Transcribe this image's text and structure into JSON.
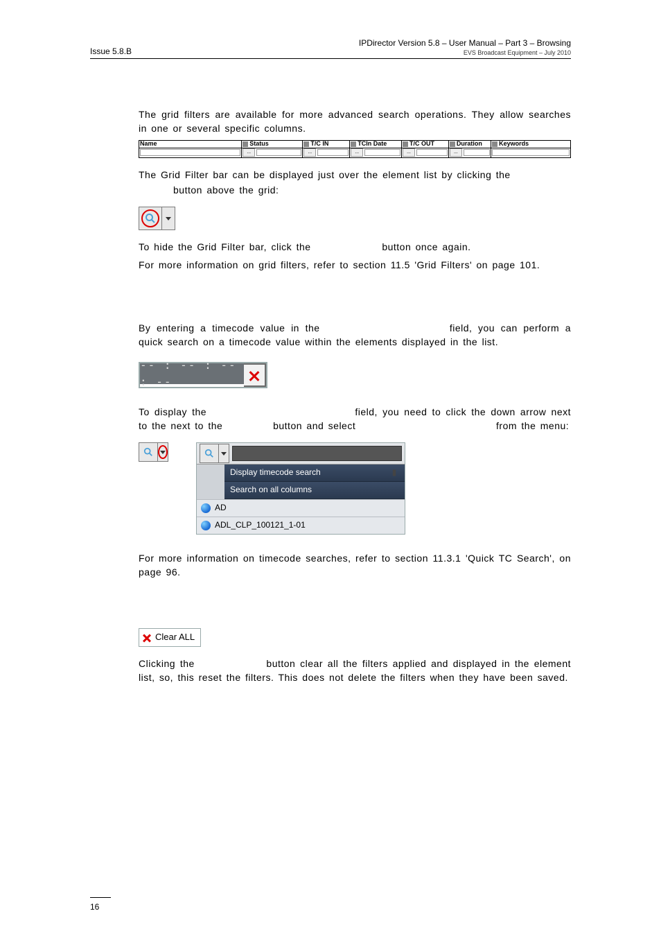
{
  "header": {
    "left": "Issue 5.8.B",
    "right_main": "IPDirector Version 5.8 – User Manual – Part 3 – Browsing",
    "right_sub": "EVS Broadcast Equipment – July 2010"
  },
  "grid_filter": {
    "columns": [
      "Name",
      "Status",
      "T/C IN",
      "TCIn Date",
      "T/C OUT",
      "Duration",
      "Keywords"
    ]
  },
  "body": {
    "p1": "The grid filters are available for more advanced search operations. They allow searches in one or several specific columns.",
    "p2a": "The Grid Filter bar can be displayed just over the element list by clicking the",
    "p2b": "button above the grid:",
    "p3a": "To hide the Grid Filter bar, click the",
    "p3b": "button once again.",
    "p4": "For more information on grid filters, refer to section 11.5 'Grid Filters' on page 101.",
    "p5a": "By entering a timecode value in the",
    "p5b": "field, you can perform a quick search on a timecode value within the elements displayed in the list.",
    "p6a": "To display the",
    "p6b": "field, you need to click the down arrow next to the",
    "p6c": "button and select",
    "p6d": "from the menu:",
    "p7": "For more information on timecode searches, refer to section 11.3.1 'Quick TC Search', on page 96.",
    "p8a": "Clicking the",
    "p8b": "button clear all the filters applied and displayed in the element list, so, this reset the filters. This does not delete the filters when they have been saved."
  },
  "tc_placeholder": "-- : -- : -- : --",
  "menu": {
    "item1": "Display timecode search",
    "item2": "Search on all columns",
    "row1": "AD",
    "row2": "ADL_CLP_100121_1-01"
  },
  "clear_all_label": "Clear ALL",
  "page_number": "16"
}
